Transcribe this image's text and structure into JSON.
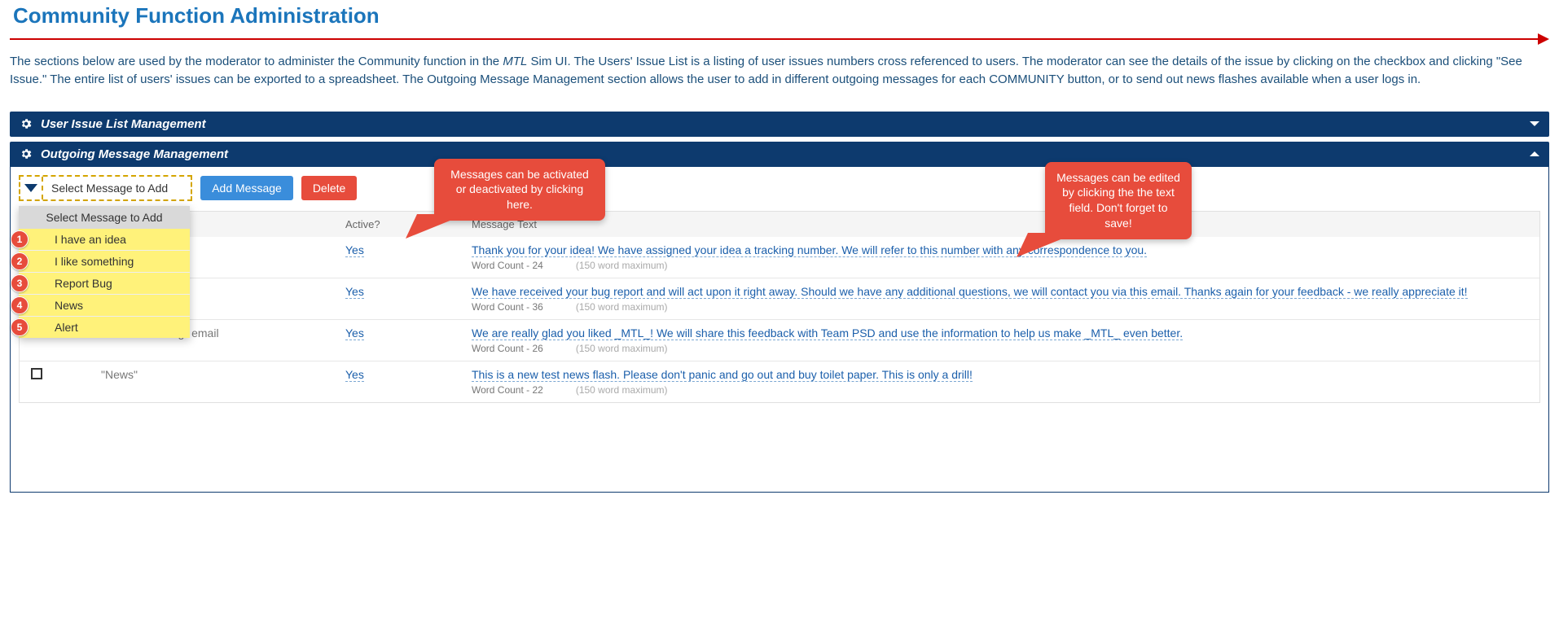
{
  "page": {
    "title": "Community Function Administration",
    "intro_1": "The sections below are used by the moderator to administer the Community function in the ",
    "intro_ital": "MTL",
    "intro_2": " Sim UI. The Users' Issue List is a listing of user issues numbers cross referenced to users. The moderator can see the details of the issue by clicking on the checkbox and clicking \"See Issue.\" The entire list of users' issues can be exported to a spreadsheet. The Outgoing Message Management section allows the user to add in different outgoing messages for each COMMUNITY button, or to send out news flashes available when a user logs in."
  },
  "panels": {
    "user_issue": {
      "title": "User Issue List Management"
    },
    "outgoing": {
      "title": "Outgoing Message Management"
    }
  },
  "toolbar": {
    "dropdown_label": "Select Message to Add",
    "dropdown_header": "Select Message to Add",
    "add_message": "Add Message",
    "delete": "Delete",
    "options": [
      {
        "num": "1",
        "label": "I have an idea"
      },
      {
        "num": "2",
        "label": "I like something"
      },
      {
        "num": "3",
        "label": "Report Bug"
      },
      {
        "num": "4",
        "label": "News"
      },
      {
        "num": "5",
        "label": "Alert"
      }
    ]
  },
  "grid": {
    "headers": {
      "active": "Active?",
      "message": "Message Text"
    },
    "word_count_prefix": "Word Count - ",
    "max_text": "(150 word maximum)",
    "rows": [
      {
        "name": "",
        "active": "Yes",
        "text": "Thank you for your idea! We have assigned your idea a tracking number. We will refer to this number with any correspondence to you.",
        "wc": "24"
      },
      {
        "name": "",
        "active": "Yes",
        "text": "We have received your bug report and will act upon it right away. Should we have any additional questions, we will contact you via this email. Thanks again for your feedback - we really appreciate it!",
        "wc": "36"
      },
      {
        "name": "\"I like something\" email",
        "active": "Yes",
        "text": "We are really glad you liked _MTL_! We will share this feedback with Team PSD and use the information to help us make _MTL_ even better.",
        "wc": "26"
      },
      {
        "name": "\"News\"",
        "active": "Yes",
        "text": "This is a new test news flash.  Please don't panic and go out and buy toilet paper.  This is only a drill!",
        "wc": "22"
      }
    ]
  },
  "callouts": {
    "c1": "Messages can be activated or deactivated by clicking here.",
    "c2": "Messages can be edited by clicking the the text field. Don't forget to save!"
  }
}
